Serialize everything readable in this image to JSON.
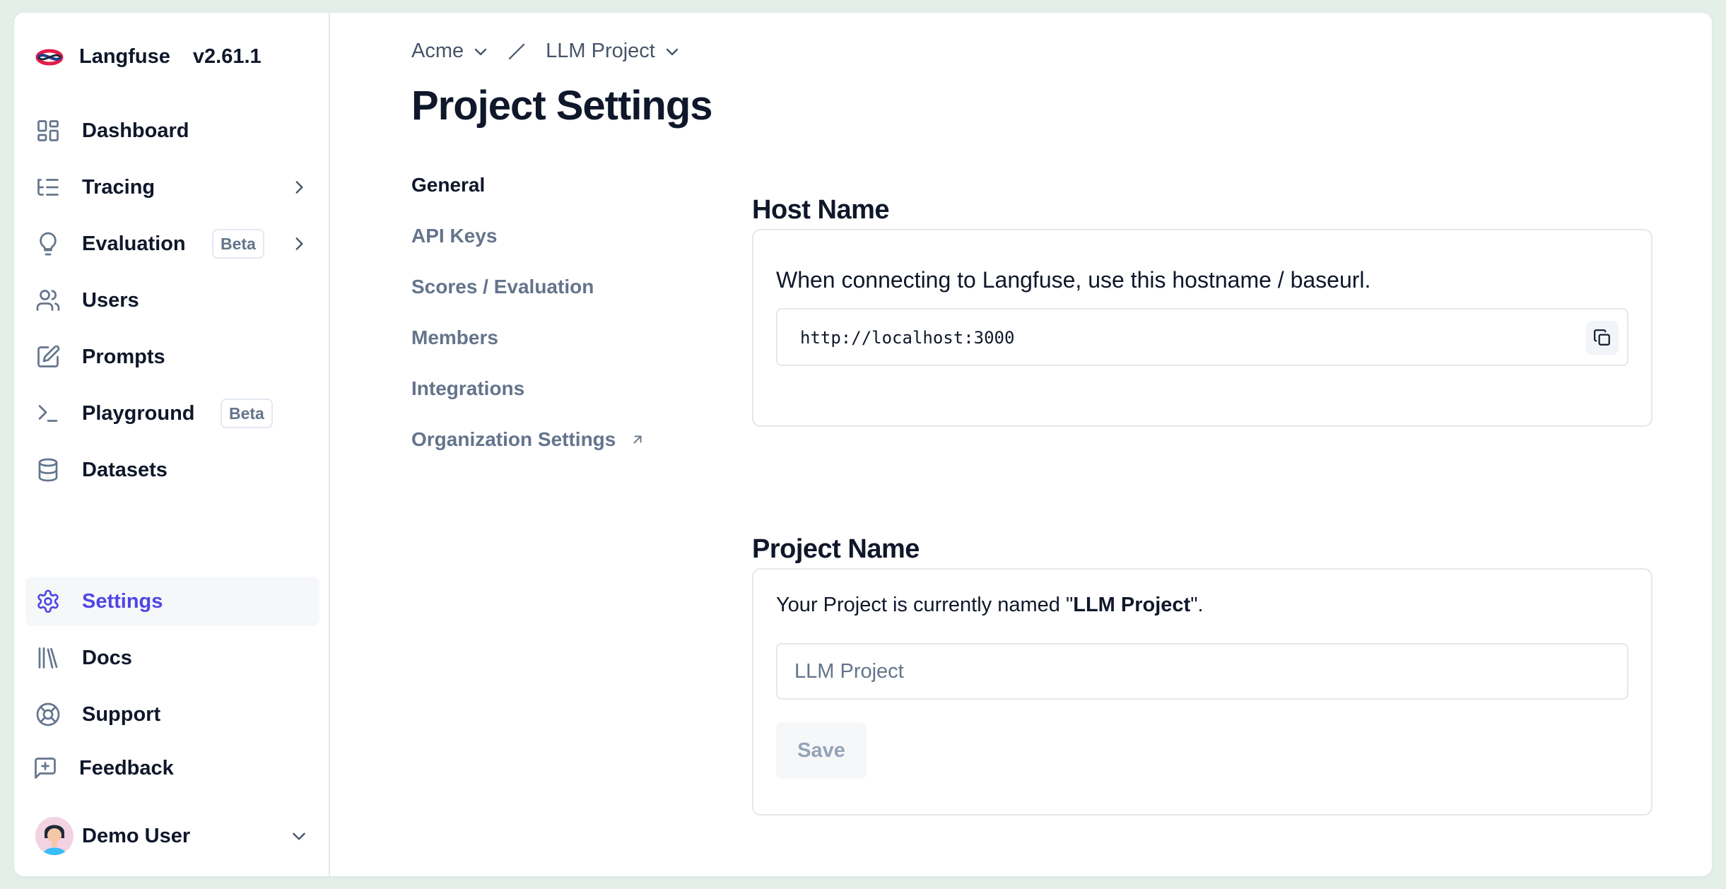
{
  "app": {
    "name": "Langfuse",
    "version": "v2.61.1"
  },
  "sidebar": {
    "items": [
      {
        "label": "Dashboard",
        "icon": "dashboard-icon"
      },
      {
        "label": "Tracing",
        "icon": "tracing-icon",
        "has_children": true
      },
      {
        "label": "Evaluation",
        "icon": "lightbulb-icon",
        "badge": "Beta",
        "has_children": true
      },
      {
        "label": "Users",
        "icon": "users-icon"
      },
      {
        "label": "Prompts",
        "icon": "edit-icon"
      },
      {
        "label": "Playground",
        "icon": "terminal-icon",
        "badge": "Beta"
      },
      {
        "label": "Datasets",
        "icon": "database-icon"
      }
    ],
    "bottom_items": [
      {
        "label": "Settings",
        "icon": "gear-icon",
        "active": true
      },
      {
        "label": "Docs",
        "icon": "library-icon"
      },
      {
        "label": "Support",
        "icon": "lifebuoy-icon"
      },
      {
        "label": "Feedback",
        "icon": "message-plus-icon"
      }
    ],
    "user": {
      "name": "Demo User"
    }
  },
  "breadcrumb": {
    "organization": "Acme",
    "project": "LLM Project"
  },
  "page": {
    "title": "Project Settings"
  },
  "subnav": {
    "items": [
      {
        "label": "General",
        "active": true
      },
      {
        "label": "API Keys"
      },
      {
        "label": "Scores / Evaluation"
      },
      {
        "label": "Members"
      },
      {
        "label": "Integrations"
      },
      {
        "label": "Organization Settings",
        "external": true
      }
    ]
  },
  "host_section": {
    "title": "Host Name",
    "description": "When connecting to Langfuse, use this hostname / baseurl.",
    "url": "http://localhost:3000"
  },
  "name_section": {
    "title": "Project Name",
    "text_before": "Your Project is currently named \"",
    "current_name": "LLM Project",
    "text_after": "\".",
    "input_placeholder": "LLM Project",
    "save_label": "Save"
  },
  "colors": {
    "accent": "#4f46e5",
    "muted_text": "#64748b",
    "border": "#e5e7eb",
    "background": "#e4efe9"
  }
}
